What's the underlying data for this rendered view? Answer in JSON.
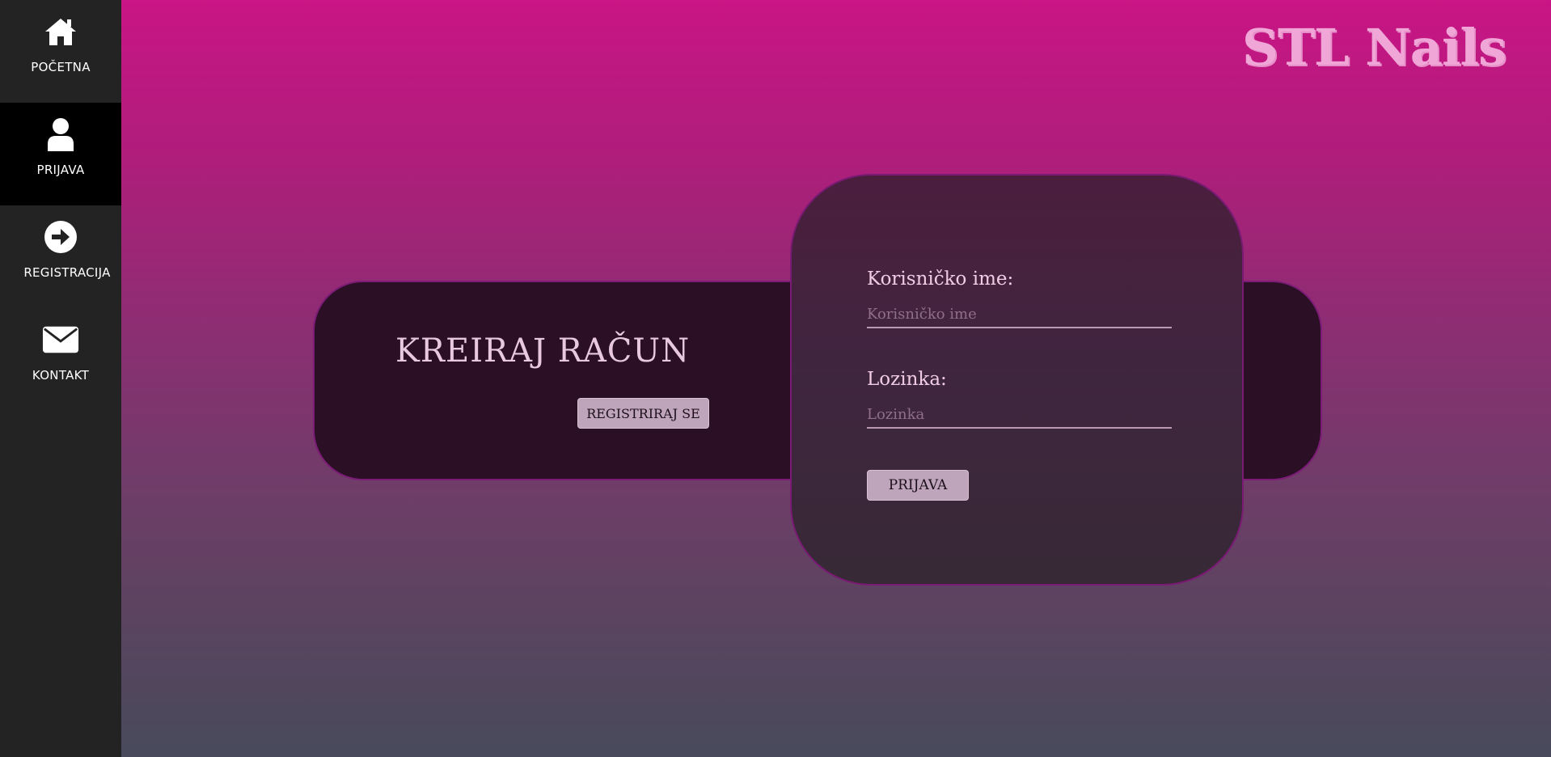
{
  "sidebar": {
    "items": [
      {
        "label": "POČETNA",
        "icon": "home-icon"
      },
      {
        "label": "PRIJAVA",
        "icon": "user-icon",
        "active": true
      },
      {
        "label": "REGISTRACIJA",
        "icon": "arrow-right-circle-icon"
      },
      {
        "label": "KONTAKT",
        "icon": "envelope-icon"
      }
    ]
  },
  "brand": {
    "name": "STL Nails"
  },
  "register": {
    "title": "KREIRAJ RAČUN",
    "button_label": "REGISTRIRAJ SE"
  },
  "login": {
    "username_label": "Korisničko ime:",
    "username_placeholder": "Korisničko ime",
    "password_label": "Lozinka:",
    "password_placeholder": "Lozinka",
    "button_label": "PRIJAVA"
  },
  "colors": {
    "sidebar_bg": "#232323",
    "active_item_bg": "#000000",
    "brand": "#f0a6d6",
    "gradient_top": "#c91585",
    "gradient_bottom": "#484a5b",
    "panel_border": "#7c1c77",
    "button_bg": "#bfa5bc"
  }
}
